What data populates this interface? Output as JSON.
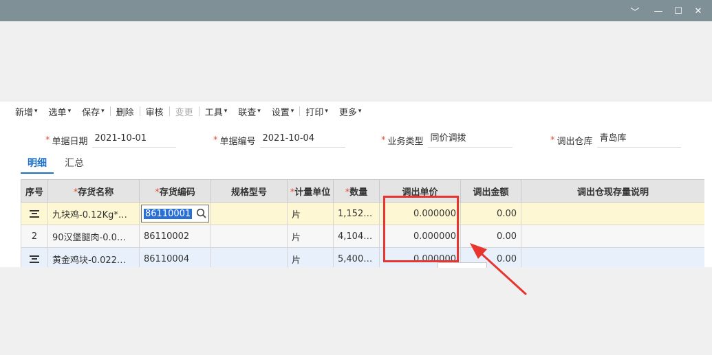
{
  "window_controls": [
    {
      "name": "collapse",
      "glyph": "﹀"
    },
    {
      "name": "minimize",
      "glyph": "—"
    },
    {
      "name": "maximize",
      "glyph": "☐"
    },
    {
      "name": "close",
      "glyph": "✕"
    }
  ],
  "toolbar": {
    "items": [
      {
        "label": "新增",
        "dropdown": true,
        "disabled": false
      },
      {
        "label": "选单",
        "dropdown": true,
        "disabled": false
      },
      {
        "label": "保存",
        "dropdown": true,
        "disabled": false
      },
      {
        "label": "删除",
        "dropdown": false,
        "disabled": false
      },
      {
        "label": "审核",
        "dropdown": false,
        "disabled": false
      },
      {
        "label": "变更",
        "dropdown": false,
        "disabled": true
      },
      {
        "label": "工具",
        "dropdown": true,
        "disabled": false
      },
      {
        "label": "联查",
        "dropdown": true,
        "disabled": false
      },
      {
        "label": "设置",
        "dropdown": true,
        "disabled": false
      },
      {
        "label": "打印",
        "dropdown": true,
        "disabled": false
      },
      {
        "label": "更多",
        "dropdown": true,
        "disabled": false
      }
    ],
    "caret": "▾"
  },
  "header": {
    "doc_date": {
      "label": "单据日期",
      "value": "2021-10-01"
    },
    "doc_no": {
      "label": "单据编号",
      "value": "2021-10-04"
    },
    "biz_type": {
      "label": "业务类型",
      "value": "同价调拨"
    },
    "out_wh": {
      "label": "调出仓库",
      "value": "青岛库"
    },
    "required_mark": "*"
  },
  "tabs": {
    "detail": "明细",
    "summary": "汇总"
  },
  "grid": {
    "columns": [
      "序号",
      "存货名称",
      "存货编码",
      "规格型号",
      "计量单位",
      "数量",
      "调出单价",
      "调出金额",
      "调出仓现存量说明"
    ],
    "rows": [
      {
        "seq": "",
        "name": "九块鸡-0.12Kg*…",
        "code": "86110001",
        "spec": "",
        "unit": "片",
        "qty": "1,152…",
        "price": "0.000000",
        "amount": "0.00",
        "note": ""
      },
      {
        "seq": "2",
        "name": "90汉堡腿肉-0.0…",
        "code": "86110002",
        "spec": "",
        "unit": "片",
        "qty": "4,104…",
        "price": "0.000000",
        "amount": "0.00",
        "note": ""
      },
      {
        "seq": "",
        "name": "黄金鸡块-0.022…",
        "code": "86110004",
        "spec": "",
        "unit": "片",
        "qty": "5,400…",
        "price": "0.000000",
        "amount": "0.00",
        "note": ""
      }
    ]
  },
  "colors": {
    "titlebar": "#7f9096",
    "accent": "#1a70c8",
    "highlight": "#e8352f",
    "required": "#e0503c"
  }
}
